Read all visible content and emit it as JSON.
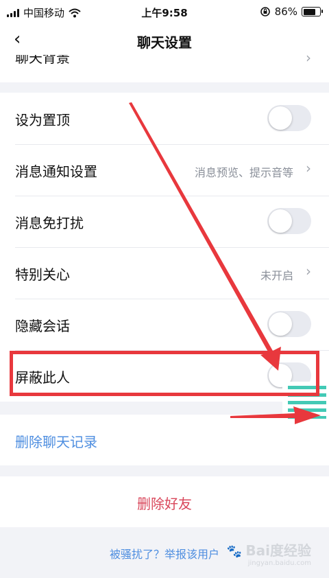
{
  "status_bar": {
    "carrier": "中国移动",
    "time": "上午9:58",
    "battery": "86%",
    "battery_level": 0.86
  },
  "nav": {
    "title": "聊天设置",
    "back": "‹"
  },
  "cut_row": {
    "label": "聊天背景",
    "chevron": "›"
  },
  "settings": {
    "pin_chat": {
      "label": "设为置顶",
      "on": false
    },
    "notification": {
      "label": "消息通知设置",
      "value": "消息预览、提示音等",
      "chevron": "›"
    },
    "dnd": {
      "label": "消息免打扰",
      "on": false
    },
    "special_care": {
      "label": "特别关心",
      "value": "未开启",
      "chevron": "›"
    },
    "hide_chat": {
      "label": "隐藏会话",
      "on": false
    },
    "block": {
      "label": "屏蔽此人",
      "on": false
    }
  },
  "clear_history": {
    "label": "删除聊天记录"
  },
  "delete_friend": {
    "label": "删除好友"
  },
  "report": {
    "label": "被骚扰了？举报该用户"
  },
  "watermark": {
    "name": "Bai度经验",
    "site": "jingyan.baidu.com"
  },
  "colors": {
    "accent_blue": "#4e8ee0",
    "danger_red": "#d9475b",
    "annotation_red": "#e8383d",
    "toggle_off": "#e8eaf0",
    "float_icon_green": "#43c9b5"
  }
}
